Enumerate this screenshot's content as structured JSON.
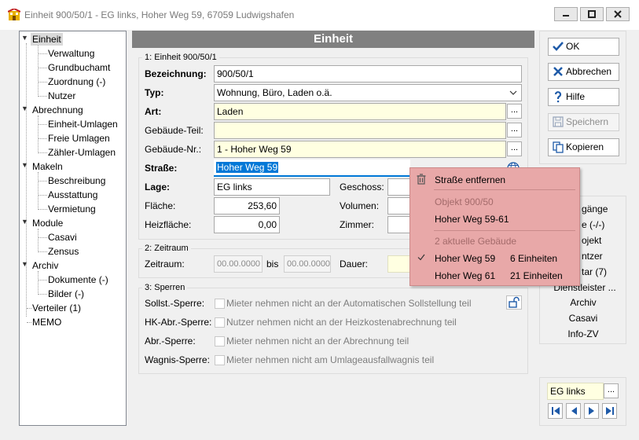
{
  "window": {
    "title": "Einheit 900/50/1 - EG links, Hoher Weg 59, 67059 Ludwigshafen",
    "minimize_label": "minimize",
    "maximize_label": "maximize",
    "close_label": "close"
  },
  "tree": {
    "items": [
      {
        "label": "Einheit"
      },
      {
        "label": "Verwaltung"
      },
      {
        "label": "Grundbuchamt"
      },
      {
        "label": "Zuordnung (-)"
      },
      {
        "label": "Nutzer"
      },
      {
        "label": "Abrechnung"
      },
      {
        "label": "Einheit-Umlagen"
      },
      {
        "label": "Freie Umlagen"
      },
      {
        "label": "Zähler-Umlagen"
      },
      {
        "label": "Makeln"
      },
      {
        "label": "Beschreibung"
      },
      {
        "label": "Ausstattung"
      },
      {
        "label": "Vermietung"
      },
      {
        "label": "Module"
      },
      {
        "label": "Casavi"
      },
      {
        "label": "Zensus"
      },
      {
        "label": "Archiv"
      },
      {
        "label": "Dokumente (-)"
      },
      {
        "label": "Bilder (-)"
      },
      {
        "label": "Verteiler (1)"
      },
      {
        "label": "MEMO"
      }
    ]
  },
  "header": {
    "title": "Einheit"
  },
  "section1": {
    "title": "1: Einheit 900/50/1",
    "bezeichnung_label": "Bezeichnung:",
    "bezeichnung_value": "900/50/1",
    "typ_label": "Typ:",
    "typ_value": "Wohnung, Büro, Laden o.ä.",
    "art_label": "Art:",
    "art_value": "Laden",
    "gebaeudeteil_label": "Gebäude-Teil:",
    "gebaeudeteil_value": "",
    "gebaeudenr_label": "Gebäude-Nr.:",
    "gebaeudenr_value": "1 - Hoher Weg 59",
    "strasse_label": "Straße:",
    "strasse_value": "Hoher Weg 59",
    "lage_label": "Lage:",
    "lage_value": "EG links",
    "geschoss_label": "Geschoss:",
    "flaeche_label": "Fläche:",
    "flaeche_value": "253,60",
    "volumen_label": "Volumen:",
    "heizflaeche_label": "Heizfläche:",
    "heizflaeche_value": "0,00",
    "zimmer_label": "Zimmer:",
    "dots": "..."
  },
  "section2": {
    "title": "2: Zeitraum",
    "zeitraum_label": "Zeitraum:",
    "from_value": "00.00.0000",
    "bis_label": "bis",
    "to_value": "00.00.0000",
    "dauer_label": "Dauer:"
  },
  "section3": {
    "title": "3: Sperren",
    "rows": [
      {
        "label": "Sollst.-Sperre:",
        "text": "Mieter nehmen nicht an der Automatischen Sollstellung teil"
      },
      {
        "label": "HK-Abr.-Sperre:",
        "text": "Nutzer nehmen nicht an der Heizkostenabrechnung teil"
      },
      {
        "label": "Abr.-Sperre:",
        "text": "Mieter nehmen nicht an der Abrechnung teil"
      },
      {
        "label": "Wagnis-Sperre:",
        "text": "Mieter nehmen nicht am Umlageausfallwagnis teil"
      }
    ]
  },
  "buttons": {
    "ok": "OK",
    "abbrechen": "Abbrechen",
    "hilfe": "Hilfe",
    "speichern": "Speichern",
    "kopieren": "Kopieren"
  },
  "context_menu": {
    "remove": "Straße entfernen",
    "objekt_header": "Objekt 900/50",
    "objekt_item": "Hoher Weg 59-61",
    "gebaeude_header": "2 aktuelle Gebäude",
    "items": [
      {
        "street": "Hoher Weg 59",
        "count": "6 Einheiten",
        "checked": true
      },
      {
        "street": "Hoher Weg 61",
        "count": "21 Einheiten",
        "checked": false
      }
    ]
  },
  "right_links": {
    "items": [
      "gänge",
      "e (-/-)",
      "ojekt",
      "ntzer",
      "tar (7)",
      "Dienstleister ...",
      "Archiv",
      "Casavi",
      "Info-ZV"
    ]
  },
  "bottom_nav": {
    "current": "EG links",
    "dots": "..."
  },
  "colors": {
    "header_bg": "#808080",
    "required_field_bg": "#ffffe1",
    "menu_bg": "#e8a8a8",
    "selection_blue": "#0078d7",
    "icon_blue": "#1e5aa8"
  }
}
